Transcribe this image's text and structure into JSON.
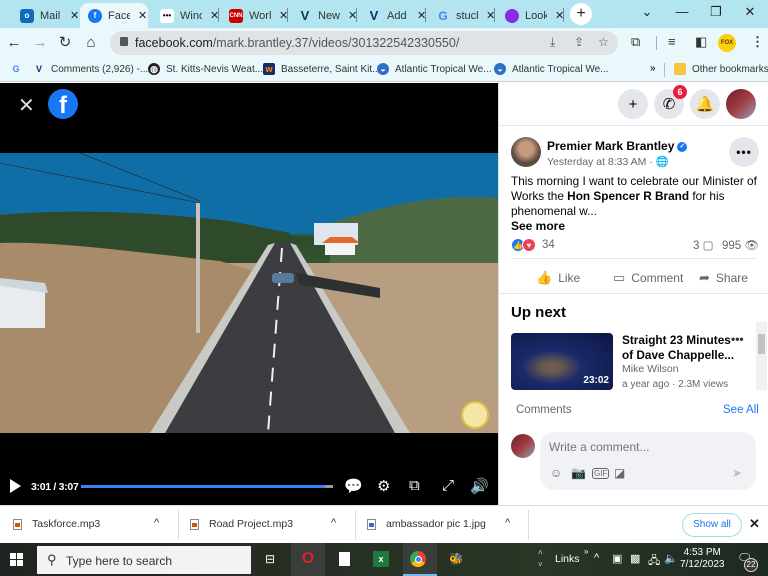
{
  "browser": {
    "tabs": [
      {
        "title": "Mail",
        "icon": "outlook-icon",
        "color": "#0f6cbd"
      },
      {
        "title": "Facebook",
        "icon": "facebook-icon",
        "color": "#1877f2",
        "active": true
      },
      {
        "title": "Windy",
        "icon": "windy-icon",
        "color": "#000000"
      },
      {
        "title": "World",
        "icon": "cnn-icon",
        "color": "#cc0000"
      },
      {
        "title": "News",
        "icon": "v-icon",
        "color": "#1a2a6a"
      },
      {
        "title": "Add",
        "icon": "v-icon",
        "color": "#1a2a6a"
      },
      {
        "title": "stuck",
        "icon": "google-icon",
        "color": "#4285f4"
      },
      {
        "title": "Look",
        "icon": "loom-icon",
        "color": "#8a2be2"
      }
    ],
    "tab_close": "✕",
    "new_tab": "+",
    "window_controls": {
      "tab_search": "⌄",
      "minimize": "—",
      "restore": "❐",
      "close": "✕"
    },
    "url_domain": "facebook.com",
    "url_path": "/mark.brantley.37/videos/301322542330550/",
    "bookmarks": [
      {
        "label": "Comments (2,926) -...",
        "icon": "v-icon"
      },
      {
        "label": "St. Kitts-Nevis Weat...",
        "icon": "globe-icon"
      },
      {
        "label": "Basseterre, Saint Kit...",
        "icon": "weather-icon"
      },
      {
        "label": "Atlantic Tropical We...",
        "icon": "noaa-icon"
      },
      {
        "label": "Atlantic Tropical We...",
        "icon": "noaa-icon"
      }
    ],
    "bookmarks_overflow": "»",
    "other_bookmarks": "Other bookmarks",
    "profile_label": "FOX"
  },
  "video": {
    "time_current": "3:01",
    "time_total": "3:07",
    "time_display": "3:01 / 3:07",
    "progress_fraction": 0.968
  },
  "facebook": {
    "messenger_badge": "6",
    "post": {
      "author": "Premier Mark Brantley",
      "verified": true,
      "time": "Yesterday at 8:33 AM",
      "privacy": "public",
      "text_before": "This morning I want to celebrate our Minister of Works the ",
      "text_bold": "Hon Spencer R Brand",
      "text_after": " for his phenomenal w...",
      "see_more": "See more",
      "reaction_count": "34",
      "comment_count": "3",
      "view_count": "995",
      "actions": {
        "like": "Like",
        "comment": "Comment",
        "share": "Share"
      }
    },
    "up_next": {
      "heading": "Up next",
      "items": [
        {
          "title": "Straight 23 Minutes of Dave Chappelle...",
          "author": "Mike Wilson",
          "meta": "a year ago · 2.3M views",
          "duration": "23:02"
        }
      ]
    },
    "comments": {
      "label": "Comments",
      "see_all": "See All",
      "placeholder": "Write a comment..."
    }
  },
  "downloads": {
    "items": [
      {
        "name": "Taskforce.mp3",
        "type": "audio"
      },
      {
        "name": "Road Project.mp3",
        "type": "audio"
      },
      {
        "name": "ambassador pic 1.jpg",
        "type": "image"
      }
    ],
    "show_all": "Show all",
    "close": "✕"
  },
  "taskbar": {
    "search_placeholder": "Type here to search",
    "links_label": "Links",
    "time": "4:53 PM",
    "date": "7/12/2023",
    "notification_count": "22"
  },
  "colors": {
    "facebook_blue": "#1877f2",
    "badge_red": "#e41e3f",
    "tabstrip": "#b3e5f0",
    "progress": "#3b82f6"
  }
}
